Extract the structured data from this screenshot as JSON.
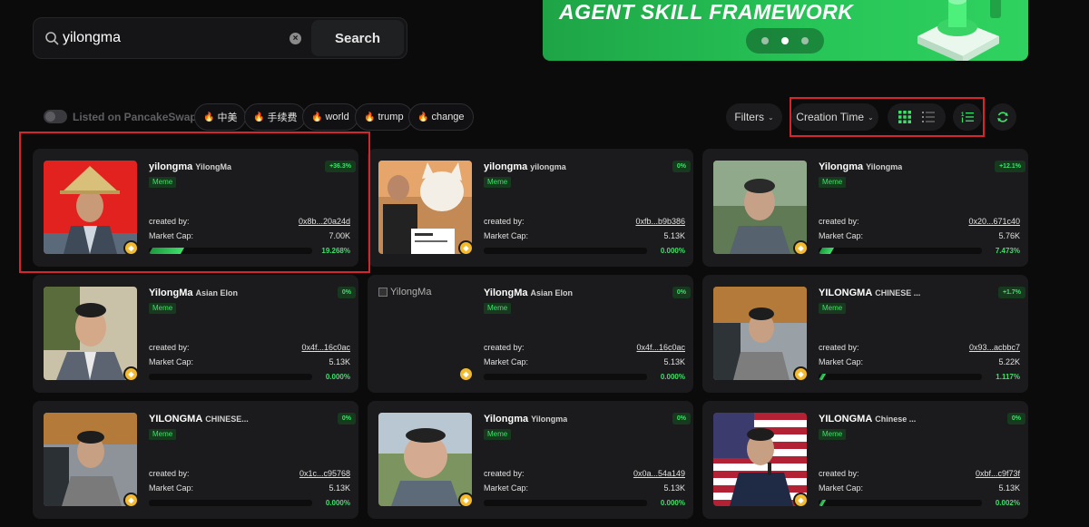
{
  "search": {
    "value": "yilongma",
    "button_label": "Search"
  },
  "banner": {
    "title": "AGENT SKILL FRAMEWORK",
    "slides": 3,
    "active_slide": 2
  },
  "filters": {
    "listed_toggle_label": "Listed on PancakeSwap",
    "listed_toggle_on": false,
    "tags": [
      "中美",
      "手续费",
      "world",
      "trump",
      "change"
    ],
    "filters_label": "Filters",
    "sort_label": "Creation Time",
    "view_mode": "grid"
  },
  "colors": {
    "accent_green": "#3ee06a",
    "banner_green": "#27c457",
    "highlight_red": "#d4262c",
    "card_bg": "#1b1b1d"
  },
  "cards": [
    {
      "name": "yilongma",
      "ticker": "YilongMa",
      "tag": "Meme",
      "change": "+36.3%",
      "creator_label": "created by:",
      "creator": "0x8b...20a24d",
      "mcap_label": "Market Cap:",
      "mcap": "7.00K",
      "progress_pct": "19.268%",
      "progress": 0.19268,
      "image": "red-hat"
    },
    {
      "name": "yilongma",
      "ticker": "yilongma",
      "tag": "Meme",
      "change": "0%",
      "creator_label": "created by:",
      "creator": "0xfb...b9b386",
      "mcap_label": "Market Cap:",
      "mcap": "5.13K",
      "progress_pct": "0.000%",
      "progress": 0,
      "image": "cat-tweet"
    },
    {
      "name": "Yilongma",
      "ticker": "Yilongma",
      "tag": "Meme",
      "change": "+12.1%",
      "creator_label": "created by:",
      "creator": "0x20...671c40",
      "mcap_label": "Market Cap:",
      "mcap": "5.76K",
      "progress_pct": "7.473%",
      "progress": 0.07473,
      "image": "blur-man"
    },
    {
      "name": "YilongMa",
      "ticker": "Asian Elon",
      "tag": "Meme",
      "change": "0%",
      "creator_label": "created by:",
      "creator": "0x4f...16c0ac",
      "mcap_label": "Market Cap:",
      "mcap": "5.13K",
      "progress_pct": "0.000%",
      "progress": 0,
      "image": "tree-man"
    },
    {
      "name": "YilongMa",
      "ticker": "Asian Elon",
      "tag": "Meme",
      "change": "0%",
      "creator_label": "created by:",
      "creator": "0x4f...16c0ac",
      "mcap_label": "Market Cap:",
      "mcap": "5.13K",
      "progress_pct": "0.000%",
      "progress": 0,
      "image": "broken",
      "broken_alt": "YilongMa"
    },
    {
      "name": "YILONGMA",
      "ticker": "CHINESE ...",
      "tag": "Meme",
      "change": "+1.7%",
      "creator_label": "created by:",
      "creator": "0x93...acbbc7",
      "mcap_label": "Market Cap:",
      "mcap": "5.22K",
      "progress_pct": "1.117%",
      "progress": 0.01117,
      "image": "car-man"
    },
    {
      "name": "YILONGMA",
      "ticker": "CHINESE...",
      "tag": "Meme",
      "change": "0%",
      "creator_label": "created by:",
      "creator": "0x1c...c95768",
      "mcap_label": "Market Cap:",
      "mcap": "5.13K",
      "progress_pct": "0.000%",
      "progress": 0,
      "image": "car-man2"
    },
    {
      "name": "Yilongma",
      "ticker": "Yilongma",
      "tag": "Meme",
      "change": "0%",
      "creator_label": "created by:",
      "creator": "0x0a...54a149",
      "mcap_label": "Market Cap:",
      "mcap": "5.13K",
      "progress_pct": "0.000%",
      "progress": 0,
      "image": "wide-face"
    },
    {
      "name": "YILONGMA",
      "ticker": "Chinese ...",
      "tag": "Meme",
      "change": "0%",
      "creator_label": "created by:",
      "creator": "0xbf...c9f73f",
      "mcap_label": "Market Cap:",
      "mcap": "5.13K",
      "progress_pct": "0.002%",
      "progress": 2e-05,
      "image": "flag-man"
    }
  ]
}
